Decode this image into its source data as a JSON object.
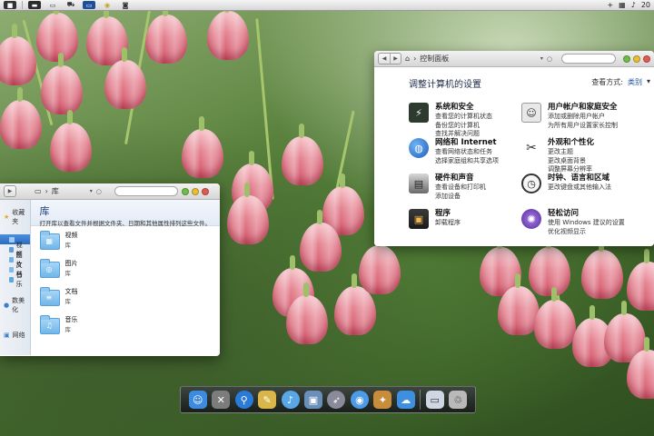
{
  "menubar": {
    "clock": "20",
    "icons": [
      "apple-menu-icon",
      "window-icon",
      "blank-icon",
      "cart-icon",
      "monitor-icon",
      "chrome-icon",
      "camera-icon"
    ]
  },
  "control_panel": {
    "breadcrumb": "控制面板",
    "heading": "调整计算机的设置",
    "view_label": "查看方式:",
    "view_value": "类别",
    "items": [
      {
        "name": "系统和安全",
        "links": [
          "查看您的计算机状态",
          "备份您的计算机",
          "查找并解决问题"
        ],
        "icon": "system-security-icon",
        "color": "#2d3b2f"
      },
      {
        "name": "用户帐户和家庭安全",
        "links": [
          "添加或删除用户帐户",
          "为所有用户设置家长控制"
        ],
        "icon": "user-accounts-icon",
        "color": "#6a6a6a"
      },
      {
        "name": "网络和 Internet",
        "links": [
          "查看网络状态和任务",
          "选择家庭组和共享选项"
        ],
        "icon": "network-globe-icon",
        "color": "#2a6fc9"
      },
      {
        "name": "外观和个性化",
        "links": [
          "更改主题",
          "更改桌面背景",
          "调整屏幕分辨率"
        ],
        "icon": "appearance-tools-icon",
        "color": "#4a4a4a"
      },
      {
        "name": "硬件和声音",
        "links": [
          "查看设备和打印机",
          "添加设备"
        ],
        "icon": "printer-icon",
        "color": "#555555"
      },
      {
        "name": "时钟、语言和区域",
        "links": [
          "更改键盘或其他输入法"
        ],
        "icon": "clock-icon",
        "color": "#f0f0f0"
      },
      {
        "name": "程序",
        "links": [
          "卸载程序"
        ],
        "icon": "programs-icon",
        "color": "#2b2b2b"
      },
      {
        "name": "轻松访问",
        "links": [
          "使用 Windows 建议的设置",
          "优化视频显示"
        ],
        "icon": "accessibility-icon",
        "color": "#6b3fb3"
      }
    ]
  },
  "library": {
    "breadcrumb": "库",
    "title": "库",
    "description": "打开库以查看文件并根据文件夹、日期和其他属性排列这些文件。",
    "sidebar_favorites": "收藏夹",
    "sidebar_items": [
      {
        "label": "",
        "active": true
      },
      {
        "label": "视频",
        "active": false
      },
      {
        "label": "图片",
        "active": false
      },
      {
        "label": "文档",
        "active": false
      },
      {
        "label": "音乐",
        "active": false
      }
    ],
    "sidebar_homegroup": "数美化",
    "sidebar_network": "网络",
    "entries": [
      {
        "name": "视频",
        "type": "库",
        "glyph": "▦"
      },
      {
        "name": "图片",
        "type": "库",
        "glyph": "◎"
      },
      {
        "name": "文档",
        "type": "库",
        "glyph": "≡"
      },
      {
        "name": "音乐",
        "type": "库",
        "glyph": "♫"
      }
    ]
  },
  "dock": {
    "items": [
      {
        "icon": "finder-icon",
        "glyph": "☺",
        "color": "#3d8be0"
      },
      {
        "icon": "utilities-icon",
        "glyph": "✕",
        "color": "#7c7c7c"
      },
      {
        "icon": "spotlight-icon",
        "glyph": "⚲",
        "color": "#2a7ad8"
      },
      {
        "icon": "preview-icon",
        "glyph": "✎",
        "color": "#d9b64a"
      },
      {
        "icon": "itunes-icon",
        "glyph": "♪",
        "color": "#5aa7e8"
      },
      {
        "icon": "photo-icon",
        "glyph": "▣",
        "color": "#6a8fb8"
      },
      {
        "icon": "launchpad-icon",
        "glyph": "➶",
        "color": "#8a8a9a"
      },
      {
        "icon": "safari-icon",
        "glyph": "◉",
        "color": "#4d9be6"
      },
      {
        "icon": "app-store-icon",
        "glyph": "✦",
        "color": "#c98c3a"
      },
      {
        "icon": "weather-icon",
        "glyph": "☁",
        "color": "#3f8fe0"
      },
      {
        "icon": "desktop-icon",
        "glyph": "▭",
        "color": "#cfd8e2"
      },
      {
        "icon": "trash-icon",
        "glyph": "♲",
        "color": "#b9b9b9"
      }
    ]
  }
}
